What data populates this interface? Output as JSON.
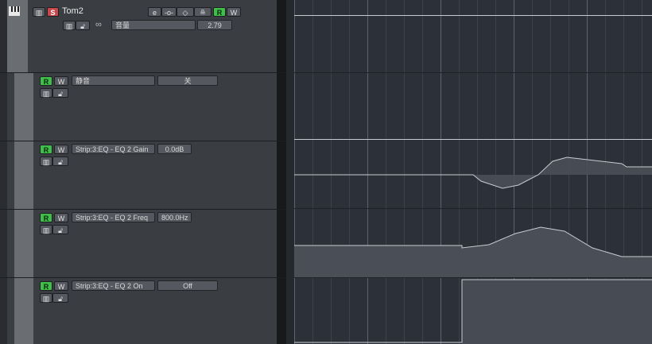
{
  "track": {
    "name": "Tom2",
    "mute_label": "M",
    "solo_label": "S",
    "read_label": "R",
    "write_label": "W",
    "param_name": "音量",
    "param_value": "2.79"
  },
  "automation_lanes": [
    {
      "read_label": "R",
      "write_label": "W",
      "param": "静音",
      "value": "关"
    },
    {
      "read_label": "R",
      "write_label": "W",
      "param": "Strip:3:EQ - EQ 2 Gain",
      "value": "0.0dB"
    },
    {
      "read_label": "R",
      "write_label": "W",
      "param": "Strip:3:EQ - EQ 2 Freq",
      "value": "800.0Hz"
    },
    {
      "read_label": "R",
      "write_label": "W",
      "param": "Strip:3:EQ - EQ 2 On",
      "value": "Off"
    }
  ],
  "icons": {
    "keyboard": "keyboard-icon",
    "lock": "lock-icon",
    "link": "link-icon",
    "edit": "e-icon",
    "insert": "insert-icon",
    "eq": "eq-icon",
    "send": "send-icon"
  },
  "colors": {
    "read_green": "#3fbf49",
    "solo_red": "#c9484c",
    "lane_bg": "#2c3038",
    "curve": "#c8ccd2"
  }
}
